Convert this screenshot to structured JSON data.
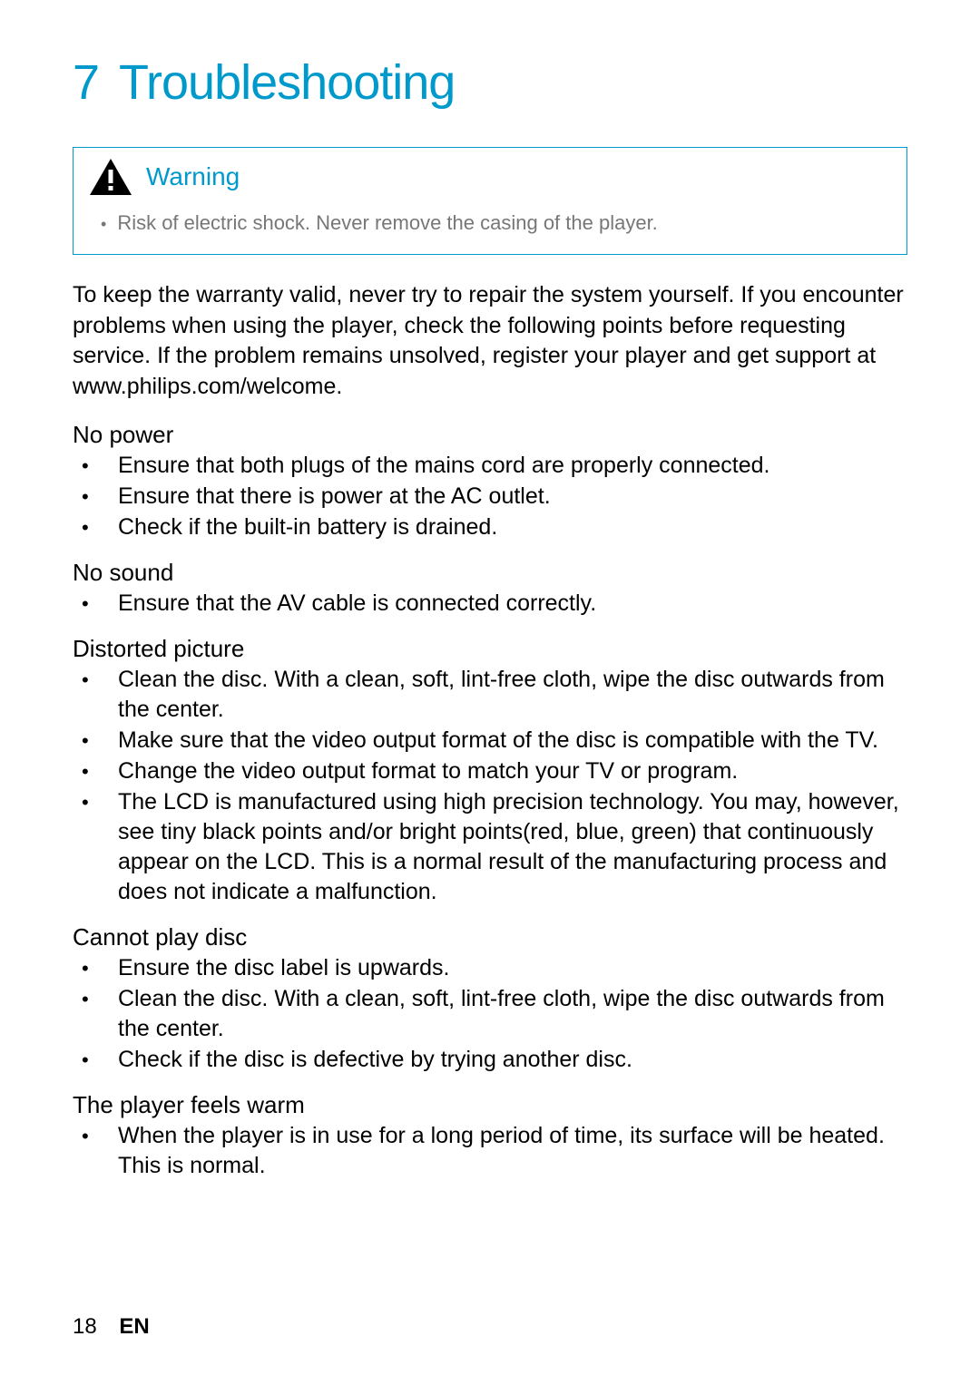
{
  "chapter": {
    "number": "7",
    "title": "Troubleshooting"
  },
  "warning": {
    "title": "Warning",
    "text": "Risk of electric shock. Never remove the casing of the player."
  },
  "intro": "To keep the warranty valid, never try to repair the system yourself. If you encounter problems when using the player, check the following points before requesting service. If the problem remains unsolved, register your player and get support at www.philips.com/welcome.",
  "sections": [
    {
      "heading": "No power",
      "items": [
        "Ensure that both plugs of the mains cord are properly connected.",
        "Ensure that there is power at the AC outlet.",
        "Check if the built-in battery is drained."
      ]
    },
    {
      "heading": "No sound",
      "items": [
        "Ensure that the AV cable is connected correctly."
      ]
    },
    {
      "heading": "Distorted picture",
      "items": [
        "Clean the disc. With a clean, soft, lint-free cloth, wipe the disc outwards from the center.",
        "Make sure that the video output format of the disc is compatible with the TV.",
        "Change the video output format to match your TV or program.",
        "The LCD is manufactured using high precision technology. You may, however, see tiny black points and/or bright points(red, blue, green) that continuously appear on the LCD. This is a normal result of the manufacturing process and does not indicate a malfunction."
      ]
    },
    {
      "heading": "Cannot play disc",
      "items": [
        "Ensure the disc label is upwards.",
        "Clean the disc. With a clean, soft, lint-free cloth, wipe the disc outwards from the center.",
        "Check if the disc is defective by trying another disc."
      ]
    },
    {
      "heading": "The player feels warm",
      "items": [
        "When the player is in use for a long period of time, its surface will be heated. This is normal."
      ]
    }
  ],
  "footer": {
    "page": "18",
    "lang": "EN"
  }
}
